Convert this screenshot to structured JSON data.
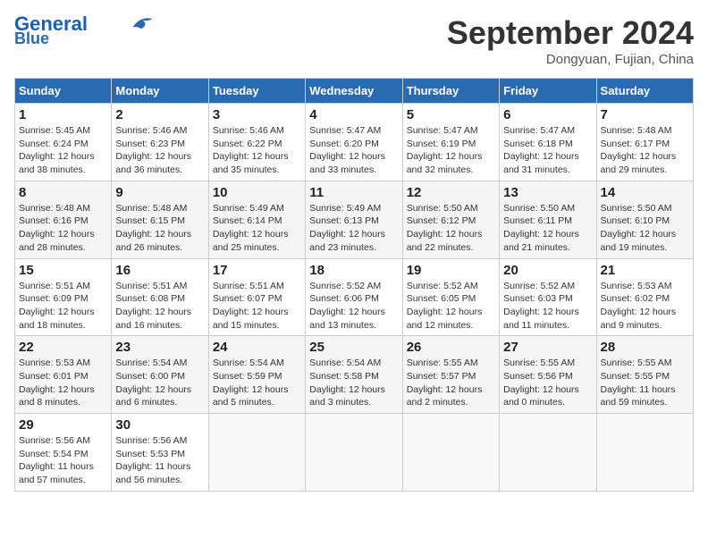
{
  "header": {
    "logo_line1": "General",
    "logo_line2": "Blue",
    "month": "September 2024",
    "location": "Dongyuan, Fujian, China"
  },
  "weekdays": [
    "Sunday",
    "Monday",
    "Tuesday",
    "Wednesday",
    "Thursday",
    "Friday",
    "Saturday"
  ],
  "weeks": [
    [
      {
        "day": "1",
        "detail": "Sunrise: 5:45 AM\nSunset: 6:24 PM\nDaylight: 12 hours\nand 38 minutes."
      },
      {
        "day": "2",
        "detail": "Sunrise: 5:46 AM\nSunset: 6:23 PM\nDaylight: 12 hours\nand 36 minutes."
      },
      {
        "day": "3",
        "detail": "Sunrise: 5:46 AM\nSunset: 6:22 PM\nDaylight: 12 hours\nand 35 minutes."
      },
      {
        "day": "4",
        "detail": "Sunrise: 5:47 AM\nSunset: 6:20 PM\nDaylight: 12 hours\nand 33 minutes."
      },
      {
        "day": "5",
        "detail": "Sunrise: 5:47 AM\nSunset: 6:19 PM\nDaylight: 12 hours\nand 32 minutes."
      },
      {
        "day": "6",
        "detail": "Sunrise: 5:47 AM\nSunset: 6:18 PM\nDaylight: 12 hours\nand 31 minutes."
      },
      {
        "day": "7",
        "detail": "Sunrise: 5:48 AM\nSunset: 6:17 PM\nDaylight: 12 hours\nand 29 minutes."
      }
    ],
    [
      {
        "day": "8",
        "detail": "Sunrise: 5:48 AM\nSunset: 6:16 PM\nDaylight: 12 hours\nand 28 minutes."
      },
      {
        "day": "9",
        "detail": "Sunrise: 5:48 AM\nSunset: 6:15 PM\nDaylight: 12 hours\nand 26 minutes."
      },
      {
        "day": "10",
        "detail": "Sunrise: 5:49 AM\nSunset: 6:14 PM\nDaylight: 12 hours\nand 25 minutes."
      },
      {
        "day": "11",
        "detail": "Sunrise: 5:49 AM\nSunset: 6:13 PM\nDaylight: 12 hours\nand 23 minutes."
      },
      {
        "day": "12",
        "detail": "Sunrise: 5:50 AM\nSunset: 6:12 PM\nDaylight: 12 hours\nand 22 minutes."
      },
      {
        "day": "13",
        "detail": "Sunrise: 5:50 AM\nSunset: 6:11 PM\nDaylight: 12 hours\nand 21 minutes."
      },
      {
        "day": "14",
        "detail": "Sunrise: 5:50 AM\nSunset: 6:10 PM\nDaylight: 12 hours\nand 19 minutes."
      }
    ],
    [
      {
        "day": "15",
        "detail": "Sunrise: 5:51 AM\nSunset: 6:09 PM\nDaylight: 12 hours\nand 18 minutes."
      },
      {
        "day": "16",
        "detail": "Sunrise: 5:51 AM\nSunset: 6:08 PM\nDaylight: 12 hours\nand 16 minutes."
      },
      {
        "day": "17",
        "detail": "Sunrise: 5:51 AM\nSunset: 6:07 PM\nDaylight: 12 hours\nand 15 minutes."
      },
      {
        "day": "18",
        "detail": "Sunrise: 5:52 AM\nSunset: 6:06 PM\nDaylight: 12 hours\nand 13 minutes."
      },
      {
        "day": "19",
        "detail": "Sunrise: 5:52 AM\nSunset: 6:05 PM\nDaylight: 12 hours\nand 12 minutes."
      },
      {
        "day": "20",
        "detail": "Sunrise: 5:52 AM\nSunset: 6:03 PM\nDaylight: 12 hours\nand 11 minutes."
      },
      {
        "day": "21",
        "detail": "Sunrise: 5:53 AM\nSunset: 6:02 PM\nDaylight: 12 hours\nand 9 minutes."
      }
    ],
    [
      {
        "day": "22",
        "detail": "Sunrise: 5:53 AM\nSunset: 6:01 PM\nDaylight: 12 hours\nand 8 minutes."
      },
      {
        "day": "23",
        "detail": "Sunrise: 5:54 AM\nSunset: 6:00 PM\nDaylight: 12 hours\nand 6 minutes."
      },
      {
        "day": "24",
        "detail": "Sunrise: 5:54 AM\nSunset: 5:59 PM\nDaylight: 12 hours\nand 5 minutes."
      },
      {
        "day": "25",
        "detail": "Sunrise: 5:54 AM\nSunset: 5:58 PM\nDaylight: 12 hours\nand 3 minutes."
      },
      {
        "day": "26",
        "detail": "Sunrise: 5:55 AM\nSunset: 5:57 PM\nDaylight: 12 hours\nand 2 minutes."
      },
      {
        "day": "27",
        "detail": "Sunrise: 5:55 AM\nSunset: 5:56 PM\nDaylight: 12 hours\nand 0 minutes."
      },
      {
        "day": "28",
        "detail": "Sunrise: 5:55 AM\nSunset: 5:55 PM\nDaylight: 11 hours\nand 59 minutes."
      }
    ],
    [
      {
        "day": "29",
        "detail": "Sunrise: 5:56 AM\nSunset: 5:54 PM\nDaylight: 11 hours\nand 57 minutes."
      },
      {
        "day": "30",
        "detail": "Sunrise: 5:56 AM\nSunset: 5:53 PM\nDaylight: 11 hours\nand 56 minutes."
      },
      {
        "day": "",
        "detail": ""
      },
      {
        "day": "",
        "detail": ""
      },
      {
        "day": "",
        "detail": ""
      },
      {
        "day": "",
        "detail": ""
      },
      {
        "day": "",
        "detail": ""
      }
    ]
  ]
}
